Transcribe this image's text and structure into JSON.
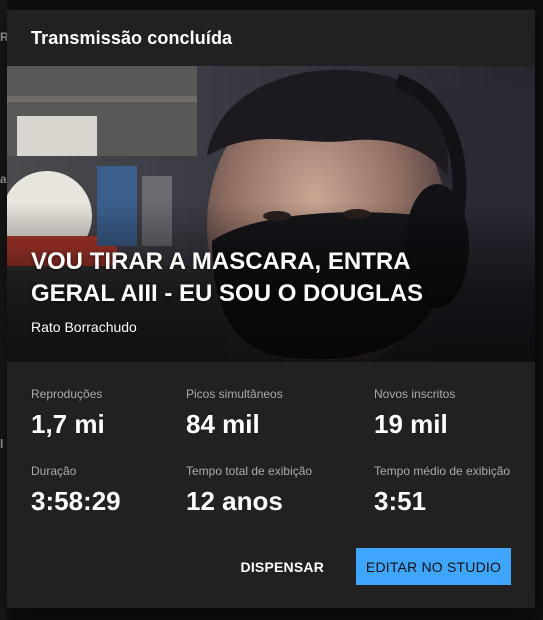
{
  "background": {
    "left_letters": [
      "R",
      "a",
      "l"
    ]
  },
  "dialog": {
    "title": "Transmissão concluída",
    "video": {
      "title": "VOU TIRAR A MASCARA, ENTRA GERAL AIII - EU SOU O DOUGLAS",
      "channel": "Rato Borrachudo"
    },
    "stats": [
      {
        "label": "Reproduções",
        "value": "1,7 mi"
      },
      {
        "label": "Picos simultâneos",
        "value": "84 mil"
      },
      {
        "label": "Novos inscritos",
        "value": "19 mil"
      },
      {
        "label": "Duração",
        "value": "3:58:29"
      },
      {
        "label": "Tempo total de exibição",
        "value": "12 anos"
      },
      {
        "label": "Tempo médio de exibição",
        "value": "3:51"
      }
    ],
    "actions": {
      "dismiss_label": "DISPENSAR",
      "edit_label": "EDITAR NO STUDIO"
    }
  },
  "colors": {
    "dialog_bg": "#212121",
    "accent": "#3ea6ff",
    "muted_text": "#aaaaaa"
  }
}
